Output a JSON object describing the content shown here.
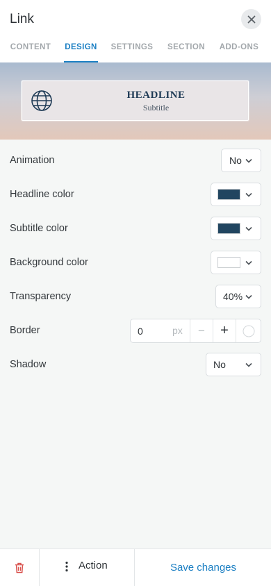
{
  "header": {
    "title": "Link",
    "close_icon": "close-icon",
    "tabs": [
      {
        "label": "CONTENT",
        "active": false
      },
      {
        "label": "DESIGN",
        "active": true
      },
      {
        "label": "SETTINGS",
        "active": false
      },
      {
        "label": "SECTION",
        "active": false
      },
      {
        "label": "ADD-ONS",
        "active": false
      }
    ]
  },
  "preview": {
    "icon": "globe-icon",
    "headline": "HEADLINE",
    "subtitle": "Subtitle"
  },
  "settings": {
    "animation": {
      "label": "Animation",
      "value": "No"
    },
    "headline_color": {
      "label": "Headline color",
      "color": "#214560"
    },
    "subtitle_color": {
      "label": "Subtitle color",
      "color": "#214560"
    },
    "background_color": {
      "label": "Background color",
      "color": "#ffffff"
    },
    "transparency": {
      "label": "Transparency",
      "value": "40%"
    },
    "border": {
      "label": "Border",
      "value": "0",
      "unit": "px",
      "decrement": "−",
      "increment": "+"
    },
    "shadow": {
      "label": "Shadow",
      "value": "No"
    }
  },
  "footer": {
    "delete_icon": "trash-icon",
    "action_label": "Action",
    "save_label": "Save changes"
  },
  "colors": {
    "accent": "#1b7fc3",
    "danger": "#d9534f"
  }
}
